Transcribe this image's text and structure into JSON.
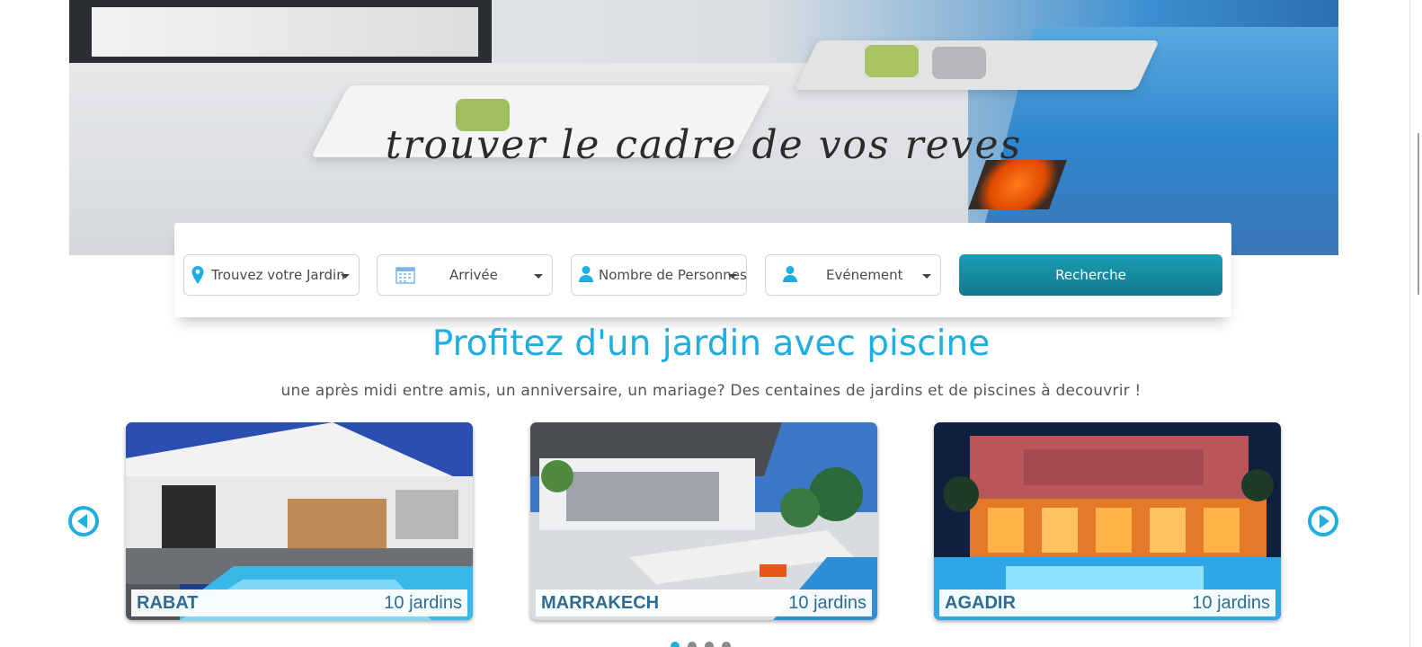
{
  "hero": {
    "tagline": "trouver le cadre de vos reves"
  },
  "search": {
    "location_label": "Trouvez votre Jardin",
    "arrival_label": "Arrivée",
    "persons_label": "Nombre de Personnes",
    "event_label": "Evénement",
    "button_label": "Recherche",
    "icons": {
      "location": "map-pin-icon",
      "arrival": "calendar-icon",
      "persons": "user-icon",
      "event": "user-icon",
      "dropdown": "caret-down-icon"
    }
  },
  "section": {
    "title": "Profitez d'un jardin avec piscine",
    "subtitle": "une après midi entre amis, un anniversaire, un mariage? Des centaines de jardins et de piscines à decouvrir !"
  },
  "carousel": {
    "prev_icon": "arrow-left-icon",
    "next_icon": "arrow-right-icon",
    "cards": [
      {
        "city": "RABAT",
        "count": "10 jardins"
      },
      {
        "city": "MARRAKECH",
        "count": "10 jardins"
      },
      {
        "city": "AGADIR",
        "count": "10 jardins"
      }
    ],
    "pagination": {
      "total": 4,
      "active": 1
    }
  },
  "colors": {
    "accent": "#1eaee0",
    "button": "#13798e",
    "card_text": "#2e6d8f"
  }
}
